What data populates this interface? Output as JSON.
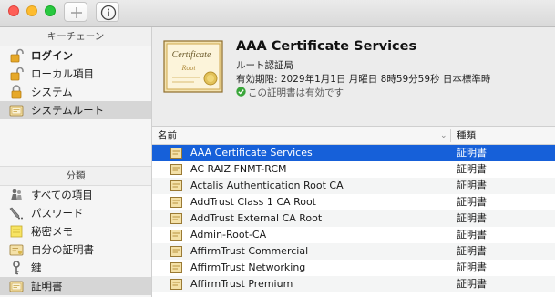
{
  "toolbar": {
    "add_button": "+",
    "info_button": "i"
  },
  "sidebar": {
    "keychains_heading": "キーチェーン",
    "keychains": [
      {
        "label": "ログイン",
        "icon": "lock-open-icon",
        "bold": true
      },
      {
        "label": "ローカル項目",
        "icon": "lock-open-icon"
      },
      {
        "label": "システム",
        "icon": "lock-icon"
      },
      {
        "label": "システムルート",
        "icon": "certificate-folder-icon",
        "selected": true
      }
    ],
    "category_heading": "分類",
    "categories": [
      {
        "label": "すべての項目",
        "icon": "people-icon"
      },
      {
        "label": "パスワード",
        "icon": "pencil-icon"
      },
      {
        "label": "秘密メモ",
        "icon": "note-icon"
      },
      {
        "label": "自分の証明書",
        "icon": "my-certificate-icon"
      },
      {
        "label": "鍵",
        "icon": "key-icon"
      },
      {
        "label": "証明書",
        "icon": "certificate-icon",
        "selected": true
      }
    ]
  },
  "header": {
    "title": "AAA Certificate Services",
    "subtitle": "ルート認証局",
    "expires": "有効期限: 2029年1月1日 月曜日 8時59分59秒 日本標準時",
    "validity": "この証明書は有効です",
    "cert_image_text_1": "Certificate",
    "cert_image_text_2": "Root"
  },
  "table": {
    "columns": {
      "name": "名前",
      "kind": "種類"
    },
    "rows": [
      {
        "name": "AAA Certificate Services",
        "kind": "証明書",
        "selected": true
      },
      {
        "name": "AC RAIZ FNMT-RCM",
        "kind": "証明書"
      },
      {
        "name": "Actalis Authentication Root CA",
        "kind": "証明書"
      },
      {
        "name": "AddTrust Class 1 CA Root",
        "kind": "証明書"
      },
      {
        "name": "AddTrust External CA Root",
        "kind": "証明書"
      },
      {
        "name": "Admin-Root-CA",
        "kind": "証明書"
      },
      {
        "name": "AffirmTrust Commercial",
        "kind": "証明書"
      },
      {
        "name": "AffirmTrust Networking",
        "kind": "証明書"
      },
      {
        "name": "AffirmTrust Premium",
        "kind": "証明書"
      }
    ]
  },
  "colors": {
    "selection": "#1660d9",
    "sidebar_selection": "#d6d6d6",
    "valid_green": "#3aa63a"
  }
}
